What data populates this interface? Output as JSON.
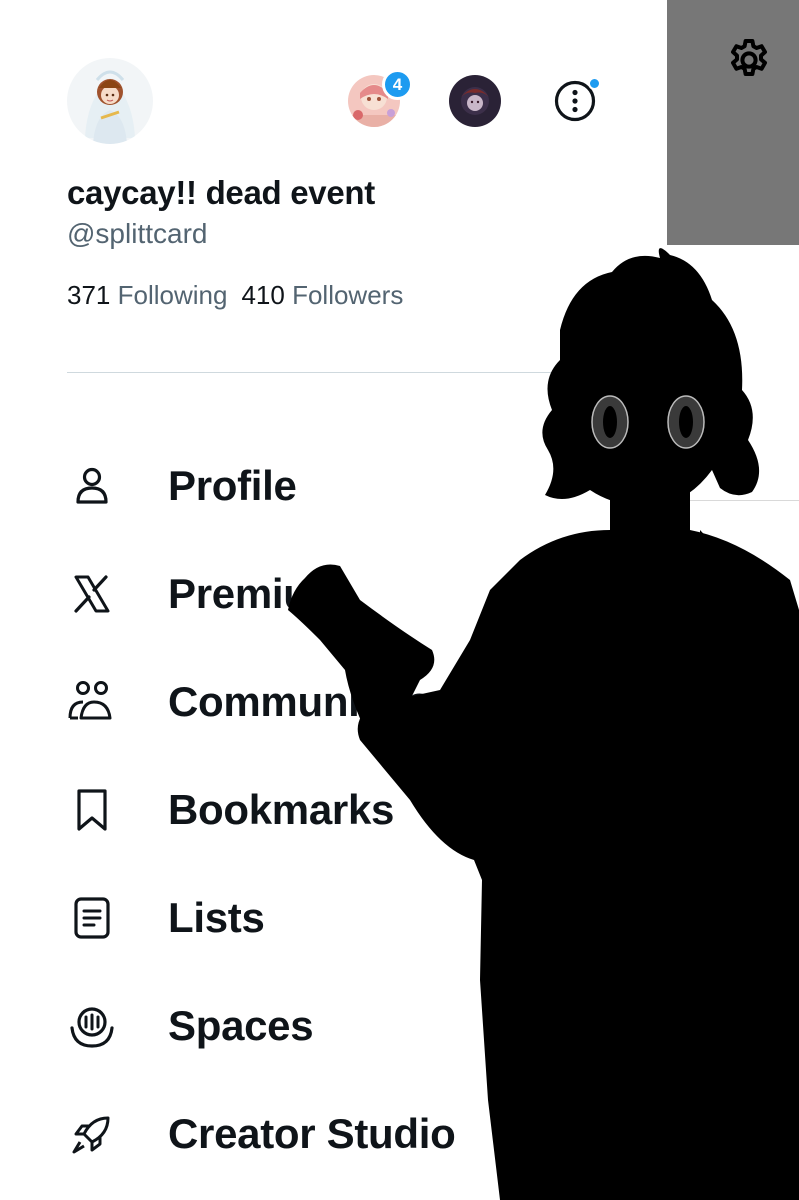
{
  "profile": {
    "display_name": "caycay!! dead event",
    "handle": "@splittcard",
    "following_count": "371",
    "following_label": "Following",
    "followers_count": "410",
    "followers_label": "Followers"
  },
  "accounts": {
    "notification_badge": "4"
  },
  "menu": [
    {
      "label": "Profile",
      "icon": "person-icon"
    },
    {
      "label": "Premium",
      "icon": "x-logo-icon"
    },
    {
      "label": "Communities",
      "icon": "communities-icon"
    },
    {
      "label": "Bookmarks",
      "icon": "bookmark-icon"
    },
    {
      "label": "Lists",
      "icon": "list-icon"
    },
    {
      "label": "Spaces",
      "icon": "spaces-icon"
    },
    {
      "label": "Creator Studio",
      "icon": "rocket-icon"
    }
  ],
  "colors": {
    "accent": "#1d9bf0",
    "text": "#0f1419",
    "secondary": "#536471",
    "dim_overlay": "#777777"
  }
}
